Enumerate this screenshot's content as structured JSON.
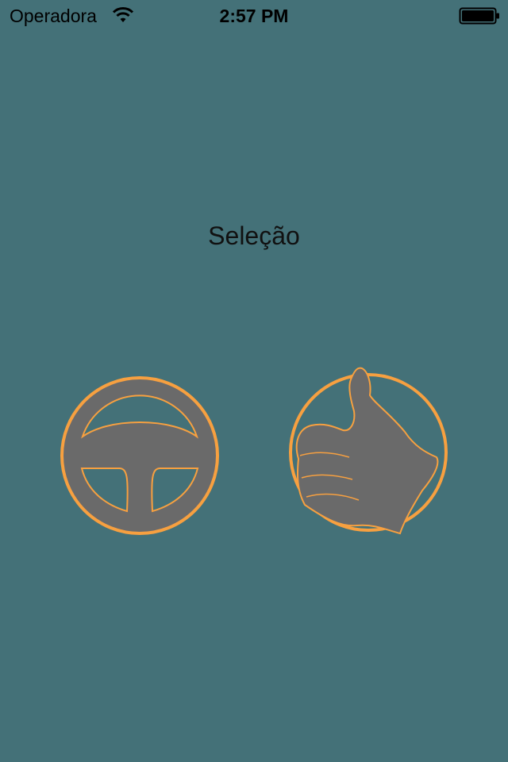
{
  "status_bar": {
    "carrier": "Operadora",
    "time": "2:57 PM",
    "wifi_icon": "wifi-icon",
    "battery_icon": "battery-icon"
  },
  "screen": {
    "title": "Seleção"
  },
  "buttons": [
    {
      "icon": "steering-wheel-icon"
    },
    {
      "icon": "thumbs-up-icon"
    }
  ],
  "colors": {
    "background": "#447178",
    "accent": "#F7A040",
    "icon_fill": "#6A6A6A",
    "text": "#111111"
  }
}
